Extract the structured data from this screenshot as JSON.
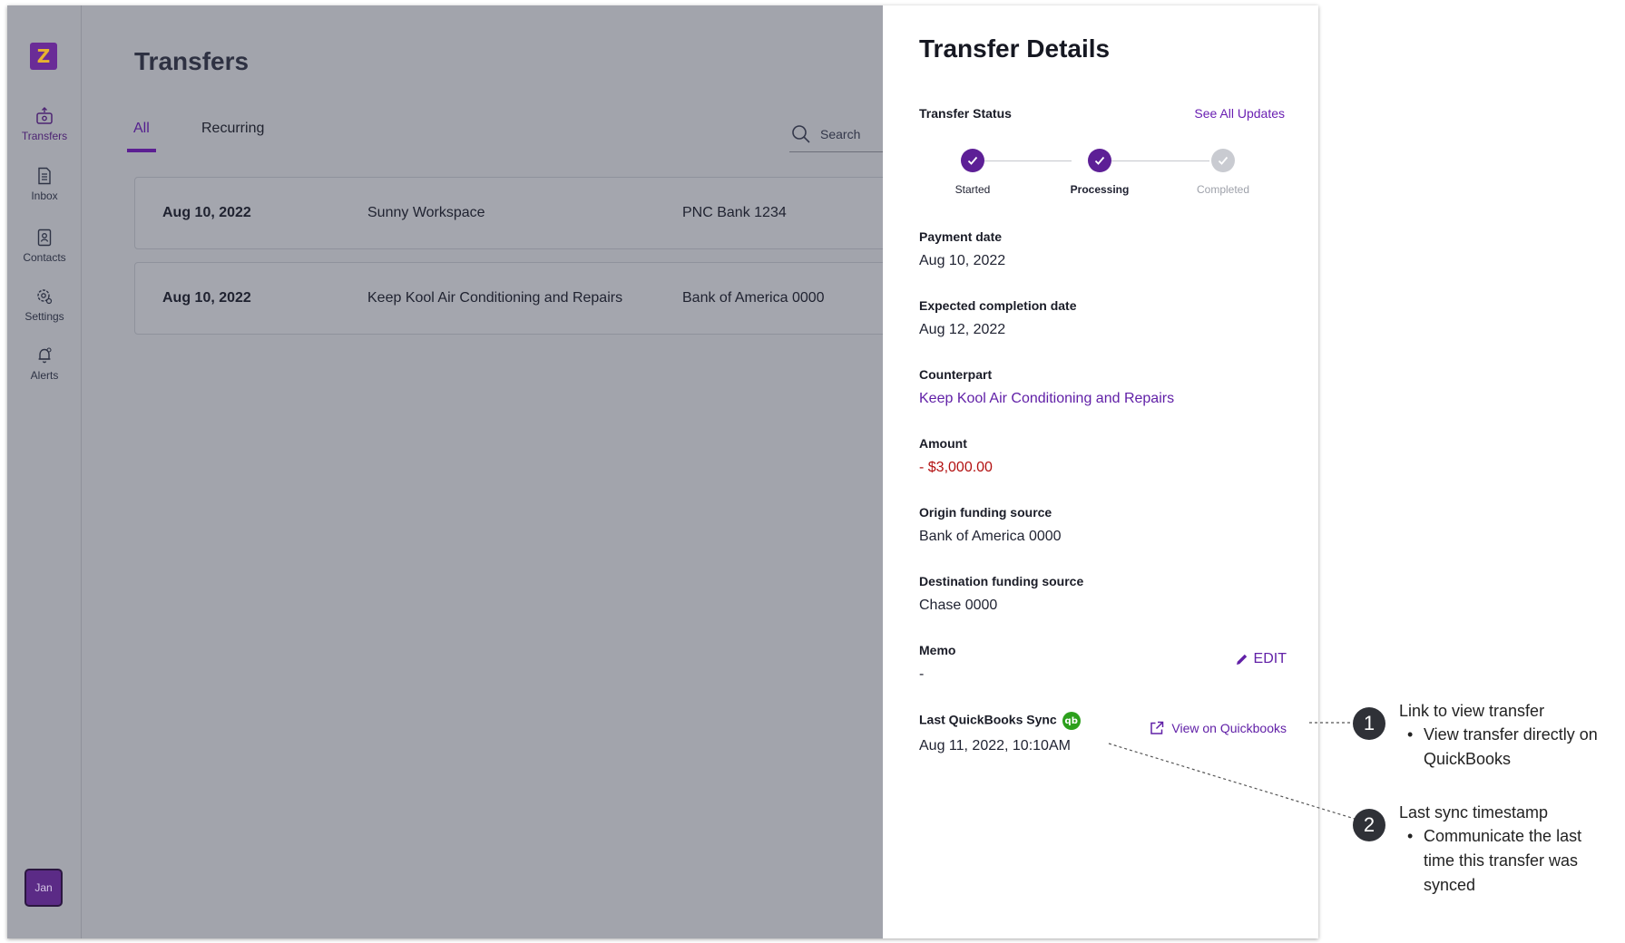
{
  "sidebar": {
    "logo": "Z",
    "items": [
      {
        "label": "Transfers",
        "icon": "transfers-icon"
      },
      {
        "label": "Inbox",
        "icon": "inbox-icon"
      },
      {
        "label": "Contacts",
        "icon": "contacts-icon"
      },
      {
        "label": "Settings",
        "icon": "settings-icon"
      },
      {
        "label": "Alerts",
        "icon": "alerts-icon"
      }
    ],
    "avatar": "Jan"
  },
  "main": {
    "title": "Transfers",
    "tabs": [
      {
        "label": "All"
      },
      {
        "label": "Recurring"
      }
    ],
    "search_label": "Search",
    "rows": [
      {
        "date": "Aug 10, 2022",
        "payee": "Sunny Workspace",
        "bank": "PNC Bank 1234"
      },
      {
        "date": "Aug 10, 2022",
        "payee": "Keep Kool Air Conditioning and Repairs",
        "bank": "Bank of America 0000"
      }
    ]
  },
  "panel": {
    "title": "Transfer Details",
    "status_label": "Transfer Status",
    "see_all": "See All Updates",
    "steps": [
      {
        "label": "Started",
        "state": "done"
      },
      {
        "label": "Processing",
        "state": "done"
      },
      {
        "label": "Completed",
        "state": "pending"
      }
    ],
    "fields": {
      "payment_date": {
        "label": "Payment date",
        "value": "Aug 10, 2022"
      },
      "expected_completion": {
        "label": "Expected completion date",
        "value": "Aug 12, 2022"
      },
      "counterpart": {
        "label": "Counterpart",
        "value": "Keep Kool Air Conditioning and Repairs"
      },
      "amount": {
        "label": "Amount",
        "value": "- $3,000.00"
      },
      "origin": {
        "label": "Origin funding source",
        "value": "Bank of America 0000"
      },
      "destination": {
        "label": "Destination funding source",
        "value": "Chase 0000"
      },
      "memo": {
        "label": "Memo",
        "value": "-"
      },
      "last_sync": {
        "label": "Last QuickBooks Sync",
        "value": "Aug 11, 2022, 10:10AM"
      }
    },
    "edit_label": "EDIT",
    "qb_badge": "qb",
    "view_quickbooks": "View on Quickbooks"
  },
  "annotations": [
    {
      "number": "1",
      "title": "Link to view transfer",
      "bullet": "View transfer directly on QuickBooks"
    },
    {
      "number": "2",
      "title": "Last sync timestamp",
      "bullet": "Communicate the last time this transfer was synced"
    }
  ],
  "colors": {
    "brand": "#5d1f96",
    "link": "#6120a7",
    "negative": "#b31111",
    "overlay": "#a2a4ac",
    "quickbooks": "#2ca01c"
  }
}
